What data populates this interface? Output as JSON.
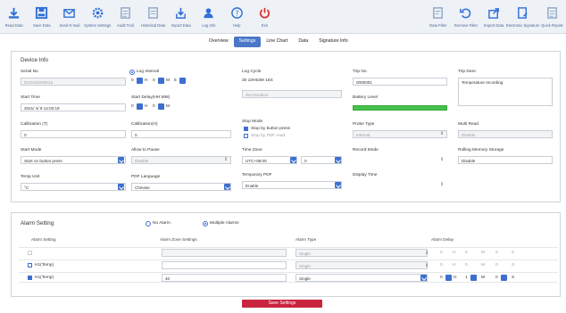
{
  "toolbar": {
    "left": [
      {
        "label": "Read Data",
        "icon": "download-icon"
      },
      {
        "label": "Save Data",
        "icon": "save-icon"
      },
      {
        "label": "Send E-mail",
        "icon": "email-icon"
      },
      {
        "label": "System Settings",
        "icon": "gear-icon"
      },
      {
        "label": "Audit Trail",
        "icon": "audit-icon"
      },
      {
        "label": "Historical Data",
        "icon": "history-icon"
      },
      {
        "label": "Import Data",
        "icon": "import-icon"
      },
      {
        "label": "Log Info",
        "icon": "user-icon"
      },
      {
        "label": "Help",
        "icon": "help-icon"
      },
      {
        "label": "Exit",
        "icon": "power-icon"
      }
    ],
    "right": [
      {
        "label": "Data Filter",
        "icon": "filter-icon"
      },
      {
        "label": "Remove Filter",
        "icon": "undo-icon"
      },
      {
        "label": "Export Data",
        "icon": "export-icon"
      },
      {
        "label": "Electronic Signature",
        "icon": "signature-icon"
      },
      {
        "label": "Quick Report",
        "icon": "report-icon"
      }
    ]
  },
  "tabs": [
    "Overview",
    "Settings",
    "Line Chart",
    "Data",
    "Signature Info"
  ],
  "active_tab": "Settings",
  "device_info": {
    "title": "Device Info",
    "serial_no_label": "Serial No",
    "serial_no": "DV2104530013",
    "log_interval_label": "Log Interval",
    "log_interval_h": "0",
    "log_interval_m": "0",
    "log_interval_s": "5",
    "unit_h": "H",
    "unit_m": "M",
    "unit_s": "S",
    "log_cycle_label": "Log Cycle",
    "log_cycle": "30 10H53M 15S",
    "log_cycle_extra": "Set Duration",
    "trip_no_label": "Trip No",
    "trip_no": "0000001",
    "trip_desc_label": "Trip Desc",
    "trip_desc": "Temperature recording",
    "start_time_label": "Start Time",
    "start_time": "2021/ 4/ 9 14:03:19",
    "start_delay_label": "Start Delay(HH:MM)",
    "start_delay_h": "0",
    "start_delay_m": "0",
    "battery_label": "Battery Level",
    "calibration_t_label": "Calibration (T)",
    "calibration_t": "0",
    "calibration_h_label": "Calibration(H)",
    "calibration_h": "0",
    "stop_mode_label": "Stop Mode",
    "stop_mode_1": "Stop by button press",
    "stop_mode_2": "Stop by PDF read",
    "probe_type_label": "Probe Type",
    "probe_type": "Internal",
    "multi_read_label": "Multi Read",
    "multi_read": "Disable",
    "start_mode_label": "Start Mode",
    "start_mode": "Start on button press",
    "allow_pause_label": "Allow to Pause",
    "allow_pause": "Disable",
    "time_zone_label": "Time Zone",
    "time_zone": "UTC+08:00",
    "time_zone_offset": "0",
    "record_mode_label": "Record Mode",
    "rolling_label": "Rolling Memory Storage",
    "rolling": "Disable",
    "temp_unit_label": "Temp Unit",
    "temp_unit": "°C",
    "pdf_language_label": "PDF Language",
    "pdf_language": "Chinese",
    "temp_pdf_label": "Temporary PDF",
    "temp_pdf": "Enable",
    "display_time_label": "Display Time"
  },
  "alarm": {
    "title": "Alarm Setting",
    "no_alarm": "No Alarm",
    "multiple_alarms": "Multiple Alarms",
    "columns": [
      "Alarm Setting",
      "Alarm Zone Settings",
      "Alarm Type",
      "Alarm Delay"
    ],
    "rows": [
      {
        "name": "",
        "zone": "",
        "type": "Single",
        "d_h": "0",
        "d_m": "0",
        "d_s": "0",
        "checked": false,
        "enabled": false
      },
      {
        "name": "H1(Temp)",
        "zone": "",
        "type": "Single",
        "d_h": "0",
        "d_m": "0",
        "d_s": "0",
        "checked": false,
        "enabled": false
      },
      {
        "name": "H1(Temp)",
        "zone": "40",
        "type": "Single",
        "d_h": "0",
        "d_m": "1",
        "d_s": "0",
        "checked": true,
        "enabled": true
      }
    ]
  },
  "footer_button": "Save Settings",
  "colors": {
    "accent": "#3d6fd0",
    "battery": "#44c24a",
    "footer": "#c9243f"
  }
}
